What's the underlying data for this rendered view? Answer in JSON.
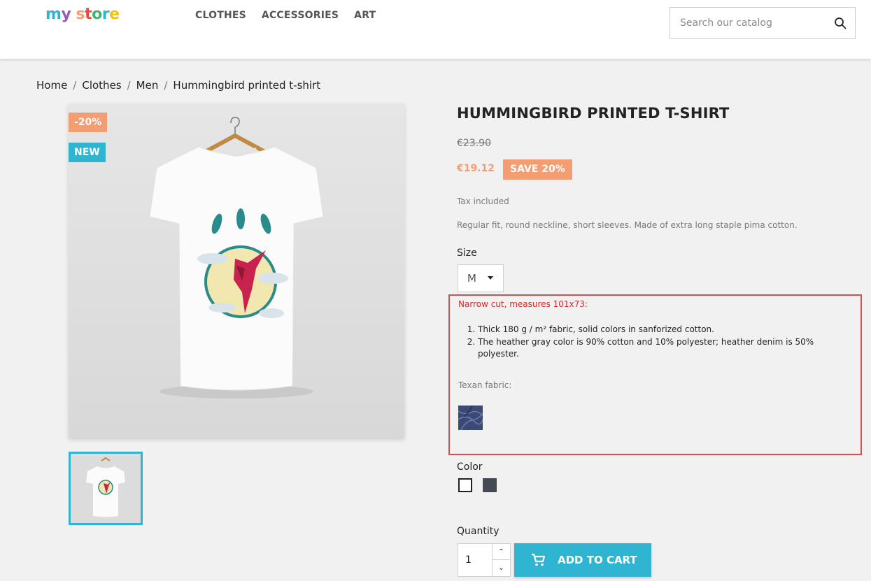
{
  "header": {
    "logo_parts": [
      "m",
      "y",
      " s",
      "t",
      "o",
      "r",
      "e"
    ],
    "nav": [
      "CLOTHES",
      "ACCESSORIES",
      "ART"
    ],
    "search_placeholder": "Search our catalog"
  },
  "breadcrumb": [
    "Home",
    "Clothes",
    "Men",
    "Hummingbird printed t-shirt"
  ],
  "breadcrumb_separator": "/",
  "product": {
    "flags": {
      "discount": "-20%",
      "new": "NEW"
    },
    "title": "HUMMINGBIRD PRINTED T-SHIRT",
    "regular_price": "€23.90",
    "current_price": "€19.12",
    "save_badge": "SAVE 20%",
    "tax_label": "Tax included",
    "short_description": "Regular fit, round neckline, short sleeves. Made of extra long staple pima cotton.",
    "size": {
      "label": "Size",
      "selected": "M"
    },
    "details": {
      "headline": "Narrow cut, measures 101x73:",
      "items": [
        "Thick 180 g / m² fabric, solid colors in sanforized cotton.",
        "The heather gray color is 90% cotton and 10% polyester; heather denim is 50% polyester."
      ],
      "fabric_label": "Texan fabric:"
    },
    "color": {
      "label": "Color",
      "swatches": [
        "#ffffff",
        "#434a54"
      ]
    },
    "quantity": {
      "label": "Quantity",
      "value": "1"
    },
    "add_to_cart": "ADD TO CART"
  },
  "colors": {
    "accent": "#2fb5d2",
    "discount": "#f39d72",
    "highlight_border": "#e04a4a",
    "detail_headline": "#d9292a"
  }
}
